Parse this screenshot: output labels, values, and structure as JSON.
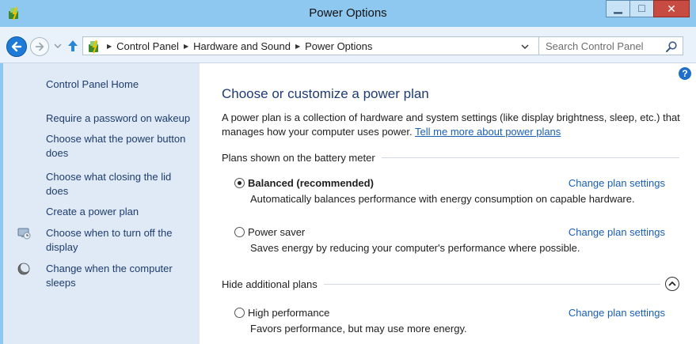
{
  "window": {
    "title": "Power Options"
  },
  "navbar": {
    "breadcrumbs": [
      "Control Panel",
      "Hardware and Sound",
      "Power Options"
    ],
    "search_placeholder": "Search Control Panel"
  },
  "sidebar": {
    "items": [
      {
        "label": "Control Panel Home",
        "icon": null
      },
      {
        "label": "Require a password on wakeup",
        "icon": null
      },
      {
        "label": "Choose what the power button does",
        "icon": null
      },
      {
        "label": "Choose what closing the lid does",
        "icon": null
      },
      {
        "label": "Create a power plan",
        "icon": null
      },
      {
        "label": "Choose when to turn off the display",
        "icon": "monitor-icon"
      },
      {
        "label": "Change when the computer sleeps",
        "icon": "moon-icon"
      }
    ]
  },
  "main": {
    "heading": "Choose or customize a power plan",
    "description": "A power plan is a collection of hardware and system settings (like display brightness, sleep, etc.) that manages how your computer uses power.",
    "description_link": "Tell me more about power plans",
    "section_battery": "Plans shown on the battery meter",
    "section_hidden": "Hide additional plans",
    "plans": [
      {
        "name": "Balanced (recommended)",
        "selected": true,
        "change": "Change plan settings",
        "desc": "Automatically balances performance with energy consumption on capable hardware."
      },
      {
        "name": "Power saver",
        "selected": false,
        "change": "Change plan settings",
        "desc": "Saves energy by reducing your computer's performance where possible."
      },
      {
        "name": "High performance",
        "selected": false,
        "change": "Change plan settings",
        "desc": "Favors performance, but may use more energy."
      }
    ]
  }
}
